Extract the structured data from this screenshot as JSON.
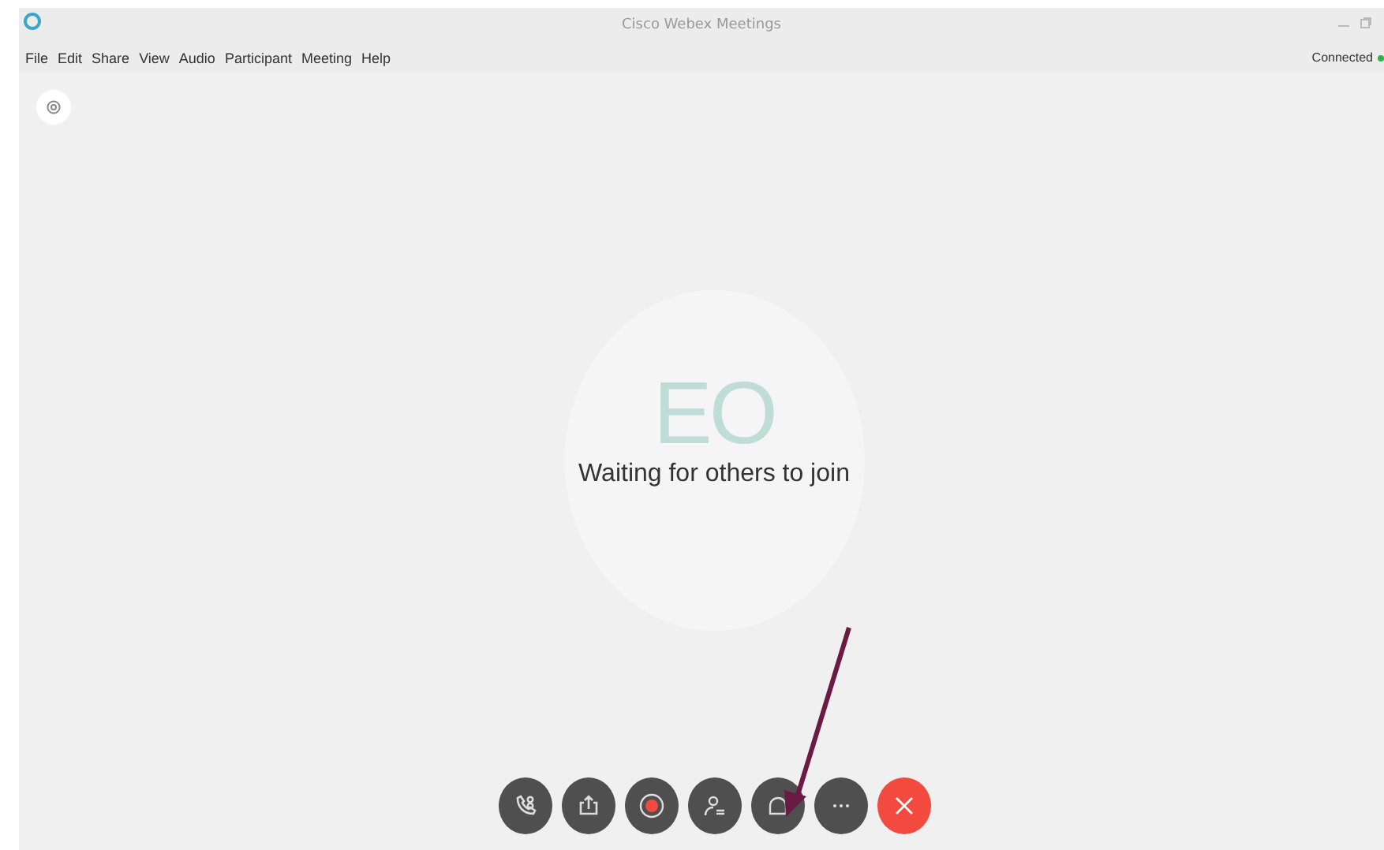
{
  "window": {
    "title": "Cisco Webex Meetings"
  },
  "menu": [
    "File",
    "Edit",
    "Share",
    "View",
    "Audio",
    "Participant",
    "Meeting",
    "Help"
  ],
  "status": {
    "label": "Connected"
  },
  "stage": {
    "initials": "EO",
    "message": "Waiting for others to join"
  },
  "controls": [
    {
      "kind": "call"
    },
    {
      "kind": "share"
    },
    {
      "kind": "record"
    },
    {
      "kind": "participants"
    },
    {
      "kind": "chat"
    },
    {
      "kind": "more"
    },
    {
      "kind": "end"
    }
  ]
}
